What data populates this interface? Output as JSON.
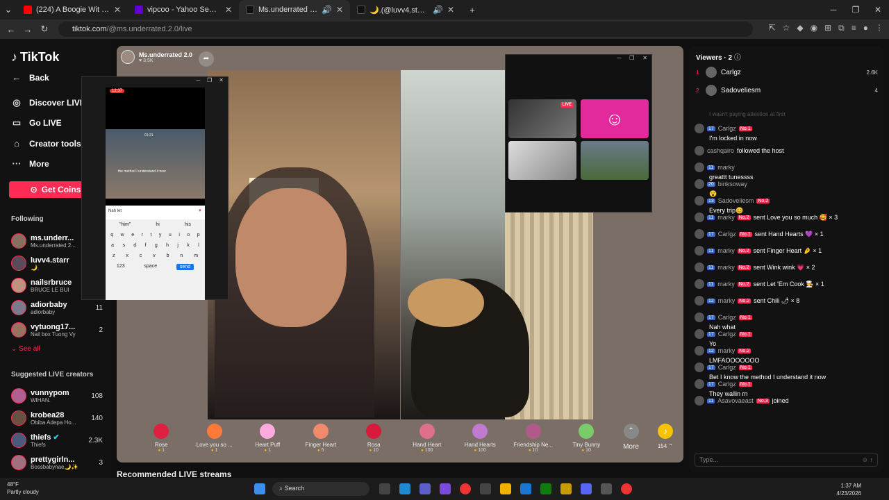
{
  "browser": {
    "tabs": [
      {
        "title": "(224) A Boogie Wit Da Hoodie",
        "color": "#ff0000"
      },
      {
        "title": "vipcoo - Yahoo Search Results",
        "color": "#6001d2"
      },
      {
        "title": "Ms.underrated 2.0 (@ms.ur",
        "color": "#111111"
      },
      {
        "title": "🌙.(@luvv4.starr) is LIVE -",
        "color": "#111111"
      }
    ],
    "url_domain": "tiktok.com",
    "url_path": "/@ms.underrated.2.0/live"
  },
  "nav": {
    "logo": "TikTok",
    "back": "Back",
    "discover": "Discover LIVE",
    "golive": "Go LIVE",
    "creator": "Creator tools",
    "more": "More",
    "coins": "Get Coins",
    "following_title": "Following",
    "following": [
      {
        "name": "ms.underr...",
        "sub": "Ms.underrated 2...",
        "count": ""
      },
      {
        "name": "luvv4.starr",
        "sub": "🌙.",
        "count": ""
      },
      {
        "name": "nailsrbruce",
        "sub": "BRUCE LE BUI",
        "count": ""
      },
      {
        "name": "adiorbaby",
        "sub": "adiorbaby",
        "count": "11"
      },
      {
        "name": "vytuong17...",
        "sub": "Nail box Tuong Vy",
        "count": "2"
      }
    ],
    "see_all": "See all",
    "suggested_title": "Suggested LIVE creators",
    "suggested": [
      {
        "name": "vunnypom",
        "sub": "WIHAN.",
        "count": "108"
      },
      {
        "name": "krobea28",
        "sub": "Obiba Adepa Ho...",
        "count": "140"
      },
      {
        "name": "thiefs",
        "sub": "Thiefs",
        "count": "2.3K"
      },
      {
        "name": "prettygirln...",
        "sub": "Bossbabynae🌙✨",
        "count": "3"
      }
    ]
  },
  "stream": {
    "host_name": "Ms.underrated 2.0",
    "host_likes": "3.5K",
    "phone_time": "12:37",
    "phone_clip_time": "01:21",
    "phone_overlay_text": "the method I understand it now",
    "phone_input": "Nah let",
    "kb_suggest": [
      "\"him\"",
      "hi",
      "his"
    ],
    "kb_row1": [
      "q",
      "w",
      "e",
      "r",
      "t",
      "y",
      "u",
      "i",
      "o",
      "p"
    ],
    "kb_row2": [
      "a",
      "s",
      "d",
      "f",
      "g",
      "h",
      "j",
      "k",
      "l"
    ],
    "kb_row3": [
      "z",
      "x",
      "c",
      "v",
      "b",
      "n",
      "m"
    ],
    "kb_space": "space",
    "kb_send": "send",
    "kb_num": "123",
    "live_badge": "LIVE",
    "recommended": "Recommended LIVE streams"
  },
  "gifts": [
    {
      "name": "Rose",
      "price": "1",
      "color": "#e02040"
    },
    {
      "name": "Love you so ...",
      "price": "1",
      "color": "#ff7a3a"
    },
    {
      "name": "Heart Puff",
      "price": "1",
      "color": "#ffaadd"
    },
    {
      "name": "Finger Heart",
      "price": "5",
      "color": "#f08a6a"
    },
    {
      "name": "Rosa",
      "price": "10",
      "color": "#d81b3c"
    },
    {
      "name": "Hand Heart",
      "price": "100",
      "color": "#e0708a"
    },
    {
      "name": "Hand Hearts",
      "price": "100",
      "color": "#c07ad0"
    },
    {
      "name": "Friendship Ne...",
      "price": "10",
      "color": "#b05a8a"
    },
    {
      "name": "Tiny Bunny",
      "price": "10",
      "color": "#7acb6a"
    }
  ],
  "gift_more": "More",
  "coin_balance": "154",
  "chat": {
    "viewers_title": "Viewers · 2",
    "viewers": [
      {
        "rank": "1",
        "name": "Carlgz",
        "value": "2.6K"
      },
      {
        "rank": "2",
        "name": "Sadoveliesm",
        "value": "4"
      }
    ],
    "faded": "I wasn't paying attention at first",
    "messages": [
      {
        "lvl": "17",
        "user": "Carlgz",
        "badge": "No.1",
        "text": "I'm locked in now"
      },
      {
        "lvl": "",
        "user": "cashqairo",
        "badge": "",
        "text": "followed the host"
      },
      {
        "lvl": "11",
        "user": "marky",
        "badge": "",
        "text": "greattt tunessss"
      },
      {
        "lvl": "20",
        "user": "binksoway",
        "badge": "",
        "text": "😮"
      },
      {
        "lvl": "13",
        "user": "Sadoveliesm",
        "badge": "No.2",
        "text": "Every trip😊"
      },
      {
        "lvl": "11",
        "user": "marky",
        "badge": "No.2",
        "text": "sent Love you so much 🥰 × 3"
      },
      {
        "lvl": "17",
        "user": "Carlgz",
        "badge": "No.1",
        "text": "sent Hand Hearts 💜 × 1"
      },
      {
        "lvl": "11",
        "user": "marky",
        "badge": "No.2",
        "text": "sent Finger Heart 🤌 × 1"
      },
      {
        "lvl": "11",
        "user": "marky",
        "badge": "No.2",
        "text": "sent Wink wink 💗 × 2"
      },
      {
        "lvl": "11",
        "user": "marky",
        "badge": "No.2",
        "text": "sent Let 'Em Cook 🧑‍🍳 × 1"
      },
      {
        "lvl": "12",
        "user": "marky",
        "badge": "No.2",
        "text": "sent Chili 🌶 × 8"
      },
      {
        "lvl": "17",
        "user": "Carlgz",
        "badge": "No.1",
        "text": "Nah what"
      },
      {
        "lvl": "17",
        "user": "Carlgz",
        "badge": "No.1",
        "text": "Yo"
      },
      {
        "lvl": "12",
        "user": "marky",
        "badge": "No.2",
        "text": "LMFAOOOOOOO"
      },
      {
        "lvl": "17",
        "user": "Carlgz",
        "badge": "No.1",
        "text": "Bet I know the method I understand it now"
      },
      {
        "lvl": "17",
        "user": "Carlgz",
        "badge": "No.1",
        "text": "They wallin rn"
      },
      {
        "lvl": "11",
        "user": "Asavovaeast",
        "badge": "No.3",
        "text": "joined"
      }
    ],
    "input_placeholder": "Type..."
  },
  "taskbar": {
    "temp": "48°F",
    "weather": "Partly cloudy",
    "search": "Search",
    "time": "1:37 AM",
    "date": "4/23/2026"
  }
}
